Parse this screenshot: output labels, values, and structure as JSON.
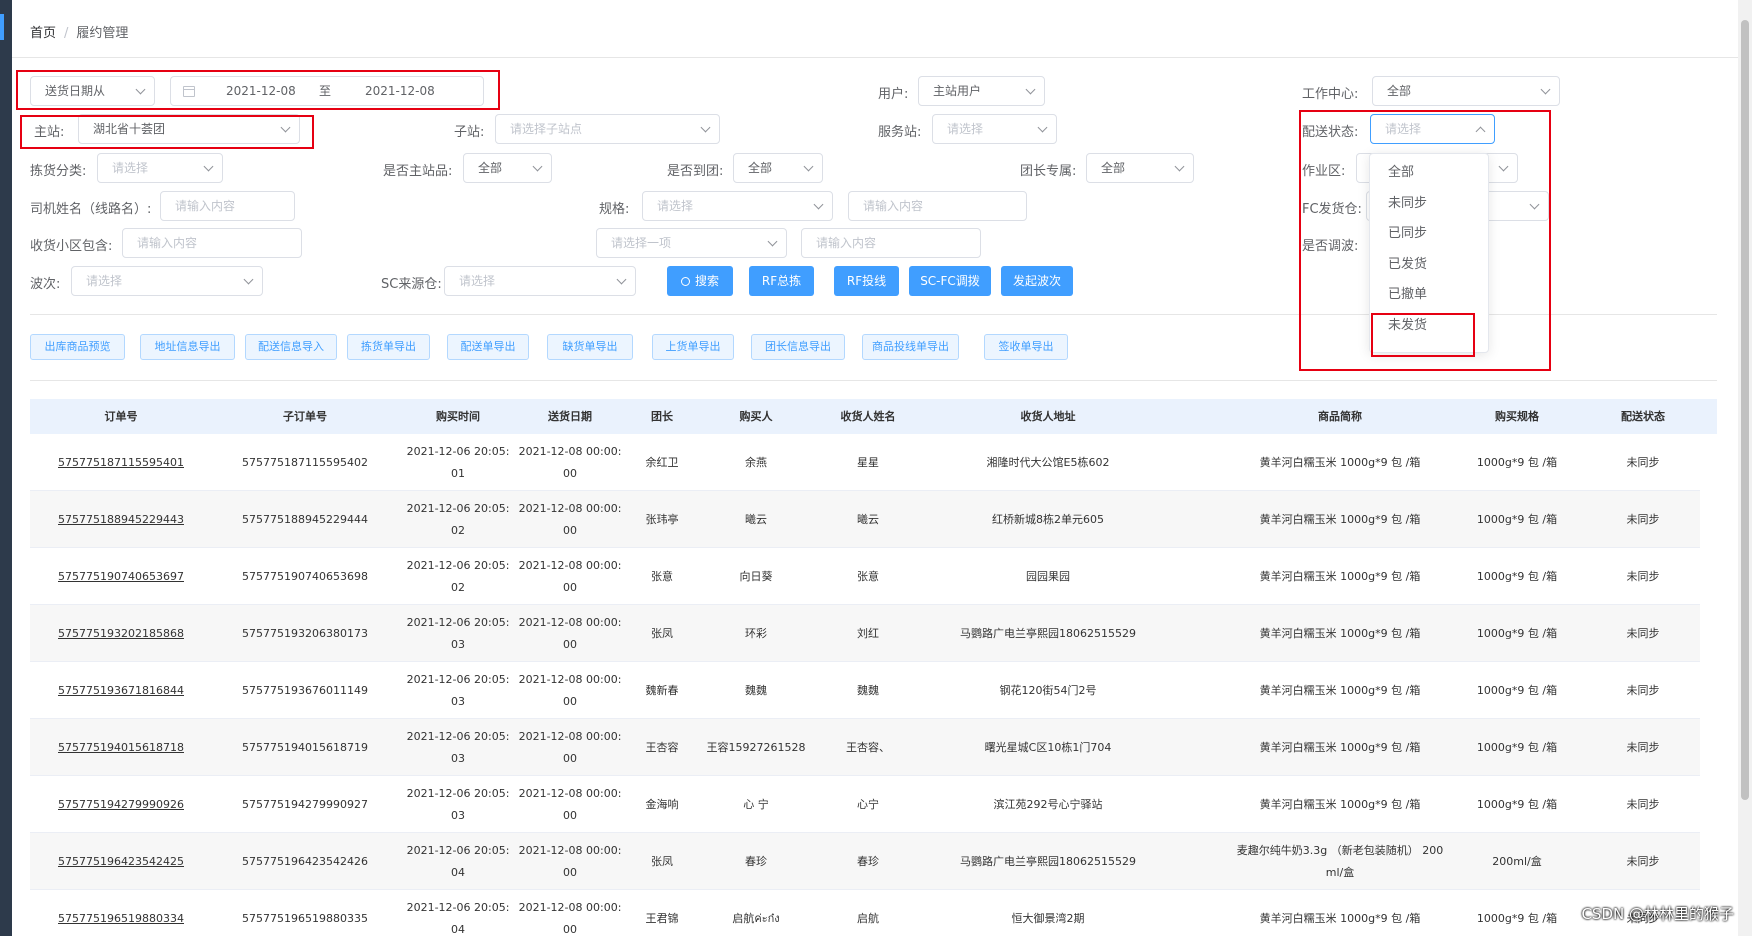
{
  "breadcrumb": {
    "home": "首页",
    "separator": "/",
    "current": "履约管理"
  },
  "filters": {
    "date_type": "送货日期从",
    "date_start": "2021-12-08",
    "date_to": "至",
    "date_end": "2021-12-08",
    "user_label": "用户:",
    "user_value": "主站用户",
    "workcenter_label": "工作中心:",
    "workcenter_value": "全部",
    "main_station_label": "主站:",
    "main_station_value": "湖北省十荟团",
    "sub_station_label": "子站:",
    "sub_station_placeholder": "请选择子站点",
    "service_station_label": "服务站:",
    "service_station_placeholder": "请选择",
    "delivery_status_label": "配送状态:",
    "delivery_status_placeholder": "请选择",
    "pick_category_label": "拣货分类:",
    "pick_category_placeholder": "请选择",
    "is_main_item_label": "是否主站品:",
    "is_main_item_value": "全部",
    "is_to_group_label": "是否到团:",
    "is_to_group_value": "全部",
    "leader_exclusive_label": "团长专属:",
    "leader_exclusive_value": "全部",
    "work_area_label": "作业区:",
    "driver_label": "司机姓名（线路名）:",
    "driver_placeholder": "请输入内容",
    "spec_label": "规格:",
    "spec_select_placeholder": "请选择",
    "spec_input_placeholder": "请输入内容",
    "fc_label": "FC发货仓:",
    "community_label": "收货小区包含:",
    "community_placeholder": "请输入内容",
    "select_one_placeholder": "请选择一项",
    "select_one_input_placeholder": "请输入内容",
    "is_dispatch_label": "是否调波:",
    "wave_label": "波次:",
    "wave_placeholder": "请选择",
    "sc_label": "SC来源仓:",
    "sc_placeholder": "请选择"
  },
  "actions": {
    "search": "搜索",
    "rf_pick": "RF总拣",
    "rf_drop": "RF投线",
    "scfc": "SC-FC调拨",
    "wave": "发起波次"
  },
  "toolbar": [
    "出库商品预览",
    "地址信息导出",
    "配送信息导入",
    "拣货单导出",
    "配送单导出",
    "缺货单导出",
    "上货单导出",
    "团长信息导出",
    "商品投线单导出",
    "签收单导出"
  ],
  "dropdown": {
    "options": [
      "全部",
      "未同步",
      "已同步",
      "已发货",
      "已撤单",
      "未发货"
    ]
  },
  "table": {
    "columns": [
      "订单号",
      "子订单号",
      "购买时间",
      "送货日期",
      "团长",
      "购买人",
      "收货人姓名",
      "收货人地址",
      "商品简称",
      "购买规格",
      "配送状态"
    ],
    "rows": [
      {
        "order": "575775187115595401",
        "sub": "575775187115595402",
        "time1": "2021-12-06 20:05:",
        "time2": "01",
        "date1": "2021-12-08 00:00:",
        "date2": "00",
        "leader": "余红卫",
        "buyer": "余燕",
        "receiver": "星星",
        "address": "湘隆时代大公馆E5栋602",
        "product": "黄羊河白糯玉米 1000g*9 包 /箱",
        "product2": "",
        "spec": "1000g*9 包 /箱",
        "status": "未同步"
      },
      {
        "order": "575775188945229443",
        "sub": "575775188945229444",
        "time1": "2021-12-06 20:05:",
        "time2": "02",
        "date1": "2021-12-08 00:00:",
        "date2": "00",
        "leader": "张玮亭",
        "buyer": "曦云",
        "receiver": "曦云",
        "address": "红桥新城8栋2单元605",
        "product": "黄羊河白糯玉米 1000g*9 包 /箱",
        "product2": "",
        "spec": "1000g*9 包 /箱",
        "status": "未同步"
      },
      {
        "order": "575775190740653697",
        "sub": "575775190740653698",
        "time1": "2021-12-06 20:05:",
        "time2": "02",
        "date1": "2021-12-08 00:00:",
        "date2": "00",
        "leader": "张意",
        "buyer": "向日葵",
        "receiver": "张意",
        "address": "园园果园",
        "product": "黄羊河白糯玉米 1000g*9 包 /箱",
        "product2": "",
        "spec": "1000g*9 包 /箱",
        "status": "未同步"
      },
      {
        "order": "575775193202185868",
        "sub": "575775193206380173",
        "time1": "2021-12-06 20:05:",
        "time2": "03",
        "date1": "2021-12-08 00:00:",
        "date2": "00",
        "leader": "张凤",
        "buyer": "环彩",
        "receiver": "刘红",
        "address": "马鹦路广电兰亭熙园18062515529",
        "product": "黄羊河白糯玉米 1000g*9 包 /箱",
        "product2": "",
        "spec": "1000g*9 包 /箱",
        "status": "未同步"
      },
      {
        "order": "575775193671816844",
        "sub": "575775193676011149",
        "time1": "2021-12-06 20:05:",
        "time2": "03",
        "date1": "2021-12-08 00:00:",
        "date2": "00",
        "leader": "魏新春",
        "buyer": "魏魏",
        "receiver": "魏魏",
        "address": "钢花120街54门2号",
        "product": "黄羊河白糯玉米 1000g*9 包 /箱",
        "product2": "",
        "spec": "1000g*9 包 /箱",
        "status": "未同步"
      },
      {
        "order": "575775194015618718",
        "sub": "575775194015618719",
        "time1": "2021-12-06 20:05:",
        "time2": "03",
        "date1": "2021-12-08 00:00:",
        "date2": "00",
        "leader": "王杏容",
        "buyer": "王容15927261528",
        "receiver": "王杏容、",
        "address": "曙光星城C区10栋1门704",
        "product": "黄羊河白糯玉米 1000g*9 包 /箱",
        "product2": "",
        "spec": "1000g*9 包 /箱",
        "status": "未同步"
      },
      {
        "order": "575775194279990926",
        "sub": "575775194279990927",
        "time1": "2021-12-06 20:05:",
        "time2": "03",
        "date1": "2021-12-08 00:00:",
        "date2": "00",
        "leader": "金海响",
        "buyer": "心 宁",
        "receiver": "心宁",
        "address": "滨江苑292号心宁驿站",
        "product": "黄羊河白糯玉米 1000g*9 包 /箱",
        "product2": "",
        "spec": "1000g*9 包 /箱",
        "status": "未同步"
      },
      {
        "order": "575775196423542425",
        "sub": "575775196423542426",
        "time1": "2021-12-06 20:05:",
        "time2": "04",
        "date1": "2021-12-08 00:00:",
        "date2": "00",
        "leader": "张凤",
        "buyer": "春珍",
        "receiver": "春珍",
        "address": "马鹦路广电兰亭熙园18062515529",
        "product": "麦趣尔纯牛奶3.3g （新老包装随机） 200",
        "product2": "ml/盒",
        "spec": "200ml/盒",
        "status": "未同步"
      },
      {
        "order": "575775196519880334",
        "sub": "575775196519880335",
        "time1": "2021-12-06 20:05:",
        "time2": "04",
        "date1": "2021-12-08 00:00:",
        "date2": "00",
        "leader": "王君锦",
        "buyer": "启航ค่ะก๋ง",
        "receiver": "启航",
        "address": "恒大御景湾2期",
        "product": "黄羊河白糯玉米 1000g*9 包 /箱",
        "product2": "",
        "spec": "1000g*9 包 /箱",
        "status": "未同步"
      }
    ]
  },
  "watermark": "CSDN @林林里的猴子",
  "colors": {
    "primary": "#409eff",
    "highlight": "#e60012",
    "sidebar": "#2d3a4b"
  }
}
